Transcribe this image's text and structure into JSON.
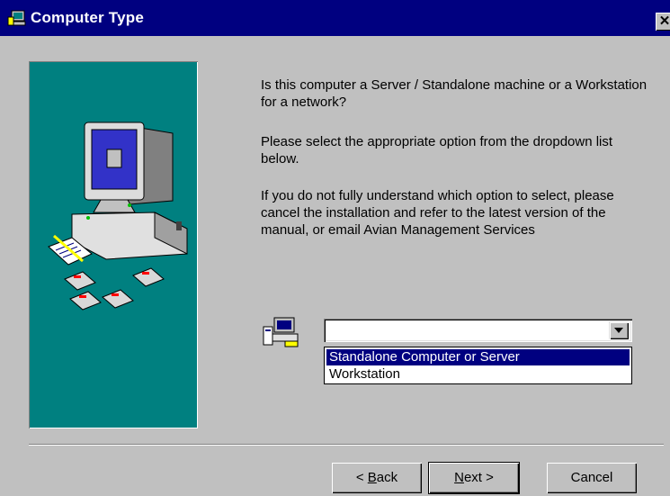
{
  "window": {
    "title": "Computer Type",
    "title_icon": "setup-computer-icon",
    "close_glyph": "✕"
  },
  "content": {
    "question": "Is this computer a Server / Standalone machine or a Workstation for a network?",
    "instruction": "Please select the appropriate option from the dropdown list below.",
    "note": "If you do not fully understand which option to select, please cancel the installation and refer to the latest version of the manual, or email Avian Management Services"
  },
  "combo": {
    "value": "",
    "options": [
      {
        "label": "Standalone Computer or Server",
        "highlighted": true
      },
      {
        "label": "Workstation",
        "highlighted": false
      }
    ]
  },
  "buttons": {
    "back": {
      "lead": "< ",
      "accel": "B",
      "rest": "ack"
    },
    "next": {
      "accel": "N",
      "rest": "ext >"
    },
    "cancel": "Cancel"
  },
  "colors": {
    "title_bar": "#000080",
    "dialog_bg": "#c0c0c0",
    "side_panel": "#008080",
    "highlight": "#000080"
  }
}
